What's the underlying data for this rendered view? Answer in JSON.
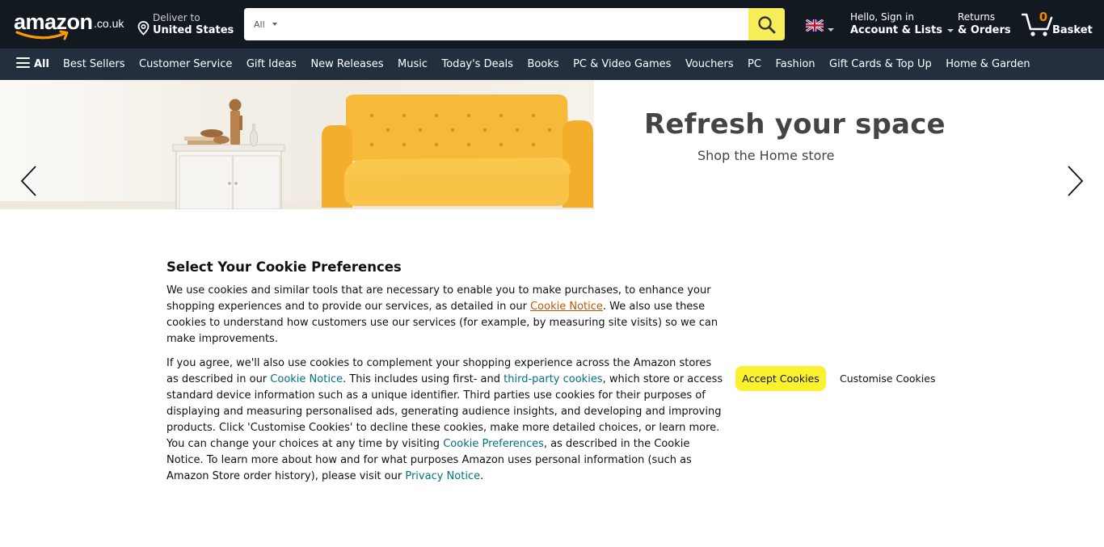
{
  "header": {
    "logo_word": "amazon",
    "logo_tld": ".co.uk",
    "deliver_line1": "Deliver to",
    "deliver_line2": "United States",
    "search": {
      "category": "All",
      "placeholder": "",
      "value": ""
    },
    "account_line1": "Hello, Sign in",
    "account_line2": "Account & Lists",
    "returns_line1": "Returns",
    "returns_line2": "& Orders",
    "basket_count": "0",
    "basket_label": "Basket"
  },
  "subnav": {
    "all_label": "All",
    "items": [
      {
        "label": "Best Sellers"
      },
      {
        "label": "Customer Service"
      },
      {
        "label": "Gift Ideas"
      },
      {
        "label": "New Releases"
      },
      {
        "label": "Music"
      },
      {
        "label": "Today's Deals"
      },
      {
        "label": "Books"
      },
      {
        "label": "PC & Video Games"
      },
      {
        "label": "Vouchers"
      },
      {
        "label": "PC"
      },
      {
        "label": "Fashion"
      },
      {
        "label": "Gift Cards & Top Up"
      },
      {
        "label": "Home & Garden"
      }
    ]
  },
  "hero": {
    "title": "Refresh your space",
    "subtitle": "Shop the Home store"
  },
  "cookie": {
    "title": "Select Your Cookie Preferences",
    "p1_a": "We use cookies and similar tools that are necessary to enable you to make purchases, to enhance your shopping experiences and to provide our services, as detailed in our ",
    "p1_link": "Cookie Notice",
    "p1_b": ". We also use these cookies to understand how customers use our services (for example, by measuring site visits) so we can make improvements.",
    "p2_a": "If you agree, we'll also use cookies to complement your shopping experience across the Amazon stores as described in our ",
    "p2_link1": "Cookie Notice",
    "p2_b": ". This includes using first- and ",
    "p2_link2": "third-party cookies",
    "p2_c": ", which store or access standard device information such as a unique identifier. Third parties use cookies for their purposes of displaying and measuring personalised ads, generating audience insights, and developing and improving products. Click 'Customise Cookies' to decline these cookies, make more detailed choices, or learn more. You can change your choices at any time by visiting ",
    "p2_link3": "Cookie Preferences",
    "p2_d": ", as described in the Cookie Notice. To learn more about how and for what purposes Amazon uses personal information (such as Amazon Store order history), please visit our ",
    "p2_link4": "Privacy Notice",
    "p2_e": ".",
    "accept_label": "Accept Cookies",
    "customise_label": "Customise Cookies"
  },
  "colors": {
    "nav_top": "#131921",
    "nav_sub": "#232f3e",
    "accent_orange": "#f08804",
    "accept_yellow": "#fbf12f",
    "link_teal": "#007185"
  },
  "icons": [
    "location-pin-icon",
    "search-icon",
    "uk-flag-icon",
    "cart-icon",
    "hamburger-menu-icon",
    "chevron-left-icon",
    "chevron-right-icon"
  ]
}
